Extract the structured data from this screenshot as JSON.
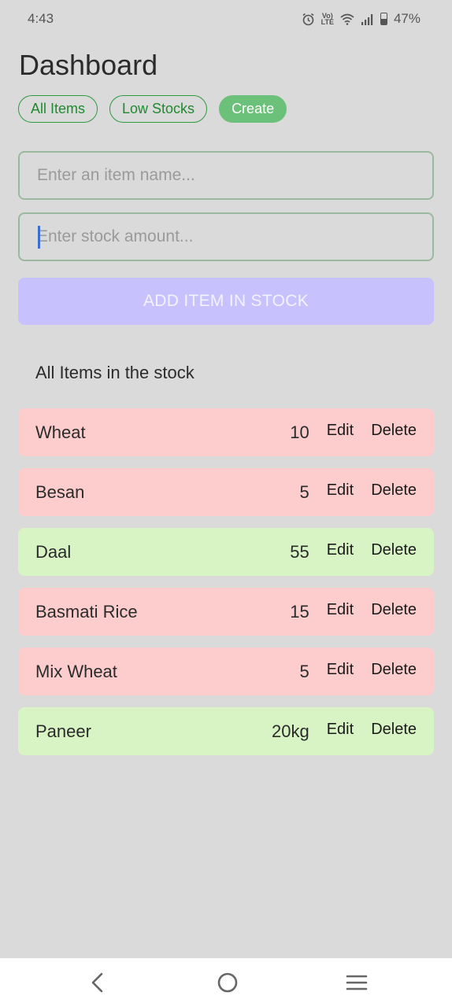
{
  "status_bar": {
    "time": "4:43",
    "battery_text": "47%",
    "battery_level": 0.47,
    "icons": [
      "alarm-icon",
      "volte-icon",
      "wifi-icon",
      "signal-icon",
      "battery-icon"
    ],
    "volte_line1": "Vo)",
    "volte_line2": "LTE"
  },
  "page": {
    "title": "Dashboard"
  },
  "tabs": [
    {
      "label": "All Items",
      "active": false
    },
    {
      "label": "Low Stocks",
      "active": false
    },
    {
      "label": "Create",
      "active": true
    }
  ],
  "form": {
    "item_name_placeholder": "Enter an item name...",
    "item_name_value": "",
    "stock_placeholder": "Enter stock amount...",
    "stock_value": "",
    "add_button_label": "ADD ITEM IN STOCK"
  },
  "section": {
    "title": "All Items in the stock"
  },
  "items": [
    {
      "name": "Wheat",
      "qty": "10",
      "status": "low",
      "edit_label": "Edit",
      "delete_label": "Delete"
    },
    {
      "name": "Besan",
      "qty": "5",
      "status": "low",
      "edit_label": "Edit",
      "delete_label": "Delete"
    },
    {
      "name": "Daal",
      "qty": "55",
      "status": "ok",
      "edit_label": "Edit",
      "delete_label": "Delete"
    },
    {
      "name": "Basmati Rice",
      "qty": "15",
      "status": "low",
      "edit_label": "Edit",
      "delete_label": "Delete"
    },
    {
      "name": "Mix Wheat",
      "qty": "5",
      "status": "low",
      "edit_label": "Edit",
      "delete_label": "Delete"
    },
    {
      "name": "Paneer",
      "qty": "20kg",
      "status": "ok",
      "edit_label": "Edit",
      "delete_label": "Delete"
    }
  ],
  "colors": {
    "low_stock_row": "#fdcdcd",
    "in_stock_row": "#d8f4c4",
    "accent_green": "#6cc17a",
    "add_button": "#c7c2fe"
  },
  "nav_bar": {
    "icons": [
      "back-icon",
      "home-icon",
      "recents-icon"
    ]
  }
}
